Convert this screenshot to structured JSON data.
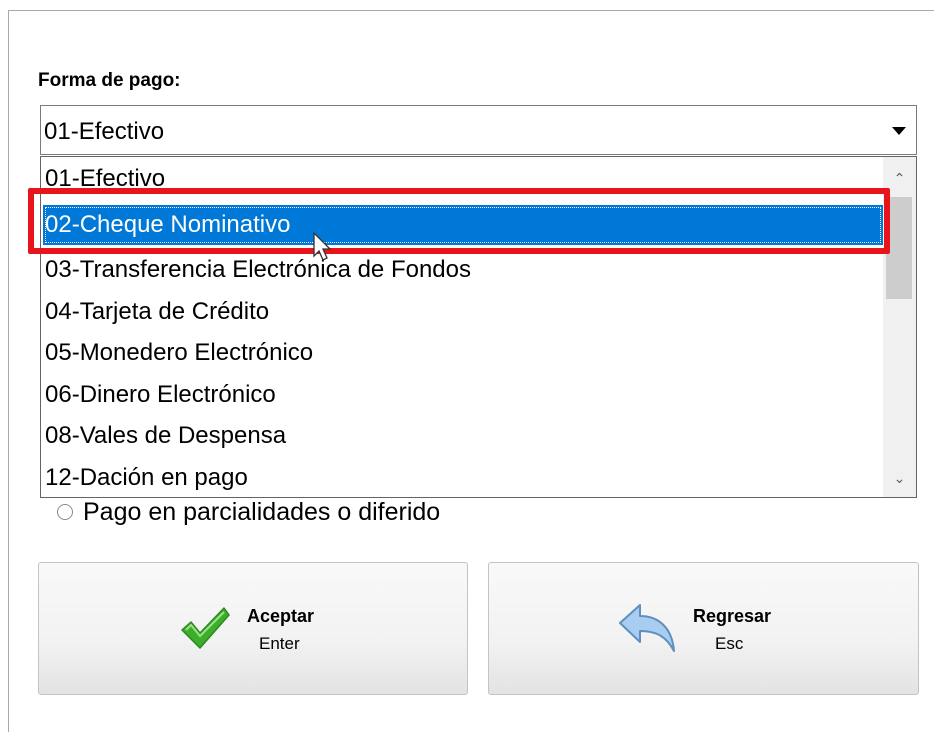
{
  "form": {
    "label": "Forma de pago:",
    "selected_value": "01-Efectivo"
  },
  "dropdown": {
    "options": [
      "01-Efectivo",
      "02-Cheque Nominativo",
      "03-Transferencia Electrónica de Fondos",
      "04-Tarjeta de Crédito",
      "05-Monedero Electrónico",
      "06-Dinero Electrónico",
      "08-Vales de Despensa",
      "12-Dación en pago"
    ],
    "highlighted_option": "02-Cheque Nominativo"
  },
  "radio": {
    "label": "Pago en parcialidades o diferido"
  },
  "buttons": {
    "accept": {
      "label": "Aceptar",
      "shortcut": "Enter",
      "icon": "checkmark-icon"
    },
    "back": {
      "label": "Regresar",
      "shortcut": "Esc",
      "icon": "back-arrow-icon"
    }
  },
  "colors": {
    "selection": "#0078d7",
    "highlight_border": "#e8141b",
    "check_green": "#3dae2b",
    "arrow_blue": "#8ab8e6"
  }
}
